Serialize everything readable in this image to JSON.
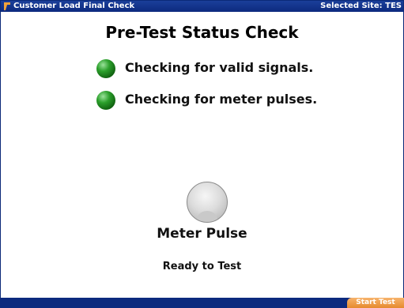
{
  "window": {
    "title": "Customer Load Final Check",
    "site_label": "Selected Site: TES",
    "icon": "app-logo-icon"
  },
  "main": {
    "heading": "Pre-Test Status Check",
    "checks": [
      {
        "label": "Checking for valid signals.",
        "status": "ok",
        "color": "#2ca02c"
      },
      {
        "label": "Checking for meter pulses.",
        "status": "ok",
        "color": "#2ca02c"
      }
    ],
    "pulse_label": "Meter Pulse",
    "pulse_state": "off",
    "status_text": "Ready to Test"
  },
  "footer": {
    "start_label": "Start Test",
    "accent": "#e68a2e",
    "bar_color": "#0c2a7e"
  }
}
